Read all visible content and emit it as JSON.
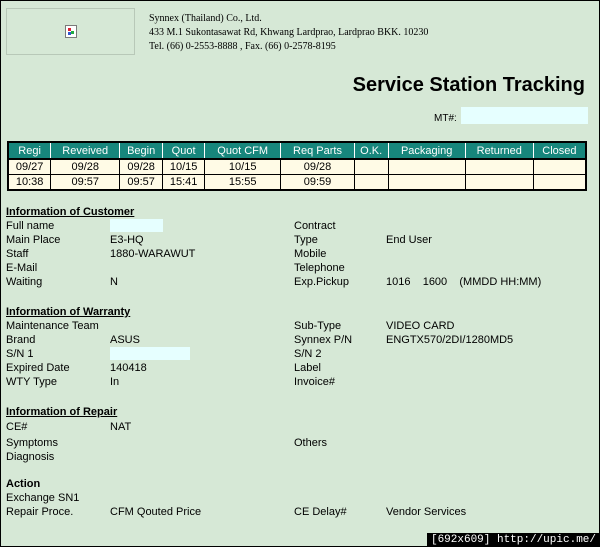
{
  "company": {
    "name": "Synnex (Thailand) Co., Ltd.",
    "address": "433 M.1 Sukontasawat Rd, Khwang Lardprao, Lardprao BKK. 10230",
    "contact": "Tel. (66) 0-2553-8888 , Fax. (66) 0-2578-8195"
  },
  "title": "Service Station Tracking",
  "mt_label": "MT#:",
  "tracking": {
    "headers": [
      "Regi",
      "Reveived",
      "Begin",
      "Quot",
      "Quot CFM",
      "Req Parts",
      "O.K.",
      "Packaging",
      "Returned",
      "Closed"
    ],
    "rows": [
      [
        "09/27",
        "09/28",
        "09/28",
        "10/15",
        "10/15",
        "09/28",
        "",
        "",
        "",
        ""
      ],
      [
        "10:38",
        "09:57",
        "09:57",
        "15:41",
        "15:55",
        "09:59",
        "",
        "",
        "",
        ""
      ]
    ]
  },
  "customer": {
    "heading": "Information of Customer",
    "full_name_label": "Full name",
    "main_place_label": "Main Place",
    "main_place": "E3-HQ",
    "staff_label": "Staff",
    "staff": "1880-WARAWUT",
    "email_label": "E-Mail",
    "waiting_label": "Waiting",
    "waiting": "N",
    "contract_label": "Contract",
    "type_label": "Type",
    "type": "End User",
    "mobile_label": "Mobile",
    "telephone_label": "Telephone",
    "exp_pickup_label": "Exp.Pickup",
    "exp_pickup": "1016    1600    (MMDD HH:MM)"
  },
  "warranty": {
    "heading": "Information of Warranty",
    "maintenance_team_label": "Maintenance Team",
    "brand_label": "Brand",
    "brand": "ASUS",
    "sn1_label": "S/N 1",
    "expired_date_label": "Expired Date",
    "expired_date": "140418",
    "wty_type_label": "WTY Type",
    "wty_type": "In",
    "sub_type_label": "Sub-Type",
    "sub_type": "VIDEO CARD",
    "synnex_pn_label": "Synnex P/N",
    "synnex_pn": "ENGTX570/2DI/1280MD5",
    "sn2_label": "S/N 2",
    "label_label": "Label",
    "invoice_label": "Invoice#"
  },
  "repair": {
    "heading": "Information of Repair",
    "ce_label": "CE#",
    "ce": "NAT",
    "symptoms_label": "Symptoms",
    "diagnosis_label": "Diagnosis",
    "others_label": "Others"
  },
  "action": {
    "heading": "Action",
    "exchange_sn1_label": "Exchange SN1",
    "repair_proc_label": "Repair Proce.",
    "repair_proc": "CFM Qouted Price",
    "ce_delay_label": "CE Delay#",
    "ce_delay": "Vendor Services"
  },
  "watermark": "[692x609] http://upic.me/"
}
